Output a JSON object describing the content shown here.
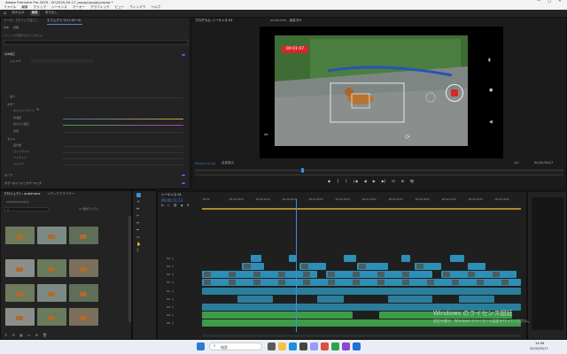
{
  "window": {
    "title": "Adobe Premiere Pro 2025 - D:\\2025-05-17_puppy\\puppy.prproj *"
  },
  "menu": [
    "ファイル",
    "編集",
    "クリップ",
    "シーケンス",
    "マーカー",
    "グラフィック",
    "ビュー",
    "ウィンドウ",
    "ヘルプ"
  ],
  "workspaces": [
    "読み込み",
    "編集",
    "書き出し"
  ],
  "effect_controls": {
    "tabs": [
      "ソース：(クリップなし)",
      "エフェクトコントロール",
      "Lumetri スコープ",
      "ソースモニター"
    ],
    "subtabs": [
      "基本",
      "詳細"
    ],
    "clip_label": "(クリップが選択されていません)",
    "sections": [
      "基本補正",
      "カラー",
      "ライト",
      "クリエイティブ",
      "カーブ",
      "カラーホイールとカラーマッチ"
    ],
    "rows": [
      "入力 LUT",
      "強さ",
      "ホワイトバランス",
      "色温度",
      "色かぶり補正",
      "彩度",
      "露光量",
      "コントラスト",
      "ハイライト",
      "シャドウ",
      "白レベル",
      "黒レベル"
    ]
  },
  "project": {
    "tabs": [
      "プロジェクト: autoframe",
      "メディアブラウザー"
    ],
    "name": "autoframe.prproj",
    "count": "17 個のアイテム",
    "clips": [
      "20250516_144431",
      "20250516_145103",
      "20250516_145209",
      "20250516_145418",
      "20250516_150022",
      "20250516_150112",
      "20250516_150445",
      "20250516_150610",
      "20250516_150733",
      "20250516_151024",
      "20250516_151300",
      "20250516_151512"
    ]
  },
  "program": {
    "title": "プログラム: シーケンス 01",
    "header_tab": "autoframe - 編集済み",
    "timer": "00:01:07",
    "timecode": "00;00;11;13",
    "fit": "全体表示",
    "quality": "1/2",
    "duration": "00;01;39;17",
    "transport": [
      "◆",
      "{",
      "}",
      "|◀",
      "◀",
      "▶",
      "▶|",
      "⊟",
      "⊞",
      "📷"
    ]
  },
  "timeline": {
    "tab": "シーケンス 01",
    "timecode": "00;00;11;13",
    "ruler": [
      ";00;00",
      ";00;00;16;00",
      ";00;00;32;00",
      ";00;00;48;00",
      ";00;01;04;00",
      ";00;01;20;00",
      ";00;01;36;00",
      ";00;01;52;00",
      ";00;02;08;00",
      ";00;02;24;00",
      ";00;02;40;00",
      ";00;02;56;00"
    ],
    "tracks": [
      {
        "name": "V4",
        "type": "v"
      },
      {
        "name": "V3",
        "type": "v"
      },
      {
        "name": "V2",
        "type": "v"
      },
      {
        "name": "V1",
        "type": "v"
      },
      {
        "name": "A1",
        "type": "a"
      },
      {
        "name": "A2",
        "type": "a"
      },
      {
        "name": "A3",
        "type": "a"
      },
      {
        "name": "A4",
        "type": "a"
      },
      {
        "name": "A5",
        "type": "a"
      }
    ]
  },
  "watermark": {
    "line1": "Windows のライセンス認証",
    "line2": "設定を開き、Windows のライセンス認証を行ってください。"
  },
  "taskbar": {
    "search": "検索",
    "time": "14:06",
    "date": "2025/05/17"
  },
  "colors": {
    "accent": "#2f8eb5",
    "record": "#d8262a",
    "audio": "#3d9c4a"
  }
}
